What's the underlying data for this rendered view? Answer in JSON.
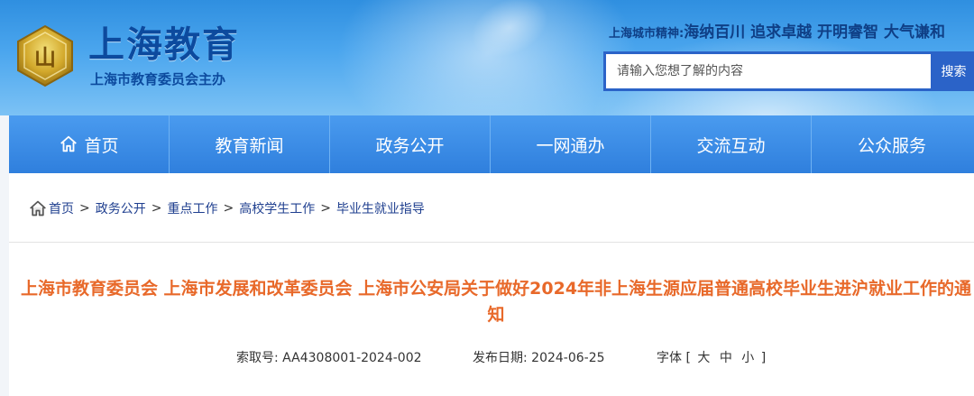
{
  "header": {
    "site_title": "上海教育",
    "site_subtitle": "上海市教育委员会主办",
    "spirit_label": "上海城市精神:",
    "spirit_text": "海纳百川 追求卓越 开明睿智 大气谦和",
    "search_placeholder": "请输入您想了解的内容",
    "search_button": "搜索",
    "logo_text": "山",
    "colors": {
      "brand": "#0c4a9e",
      "accent": "#2b63c8"
    }
  },
  "nav": {
    "items": [
      {
        "label": "首页",
        "icon": "home-icon"
      },
      {
        "label": "教育新闻"
      },
      {
        "label": "政务公开"
      },
      {
        "label": "一网通办"
      },
      {
        "label": "交流互动"
      },
      {
        "label": "公众服务"
      }
    ]
  },
  "breadcrumb": {
    "items": [
      "首页",
      "政务公开",
      "重点工作",
      "高校学生工作",
      "毕业生就业指导"
    ],
    "separator": ">"
  },
  "article": {
    "title": "上海市教育委员会 上海市发展和改革委员会 上海市公安局关于做好2024年非上海生源应届普通高校毕业生进沪就业工作的通知",
    "title_color": "#e8692a",
    "index_label": "索取号:",
    "index_value": "AA4308001-2024-002",
    "date_label": "发布日期:",
    "date_value": "2024-06-25",
    "font_label": "字体",
    "font_open": "[",
    "font_large": "大",
    "font_medium": "中",
    "font_small": "小",
    "font_close": "]"
  }
}
